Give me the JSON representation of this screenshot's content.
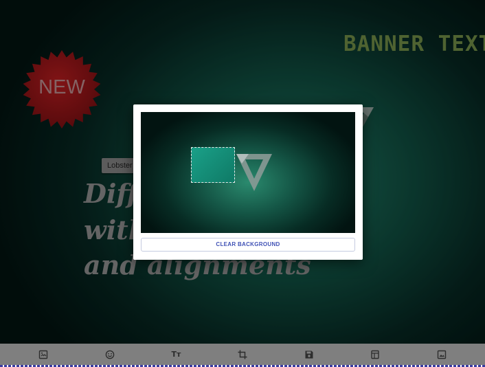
{
  "canvas": {
    "banner_text": "BANNER TEXT",
    "badge_text": "NEW",
    "font_select": {
      "value": "Lobster"
    },
    "text_lines": [
      "Diffe",
      "with",
      "and alignments"
    ]
  },
  "modal": {
    "clear_button_label": "CLEAR BACKGROUND"
  },
  "toolbar": {
    "items": [
      {
        "name": "image-upload-icon"
      },
      {
        "name": "emoji-icon"
      },
      {
        "name": "text-icon",
        "glyph": "Tт"
      },
      {
        "name": "crop-icon"
      },
      {
        "name": "save-icon"
      },
      {
        "name": "template-icon"
      },
      {
        "name": "background-image-icon"
      }
    ]
  },
  "colors": {
    "canvas_center": "#1f7a64",
    "canvas_edge": "#021310",
    "banner_text": "#6e8a45",
    "badge_red": "#8e1416",
    "button_text": "#3f51b5",
    "toolbar": "#7f7f7f"
  }
}
